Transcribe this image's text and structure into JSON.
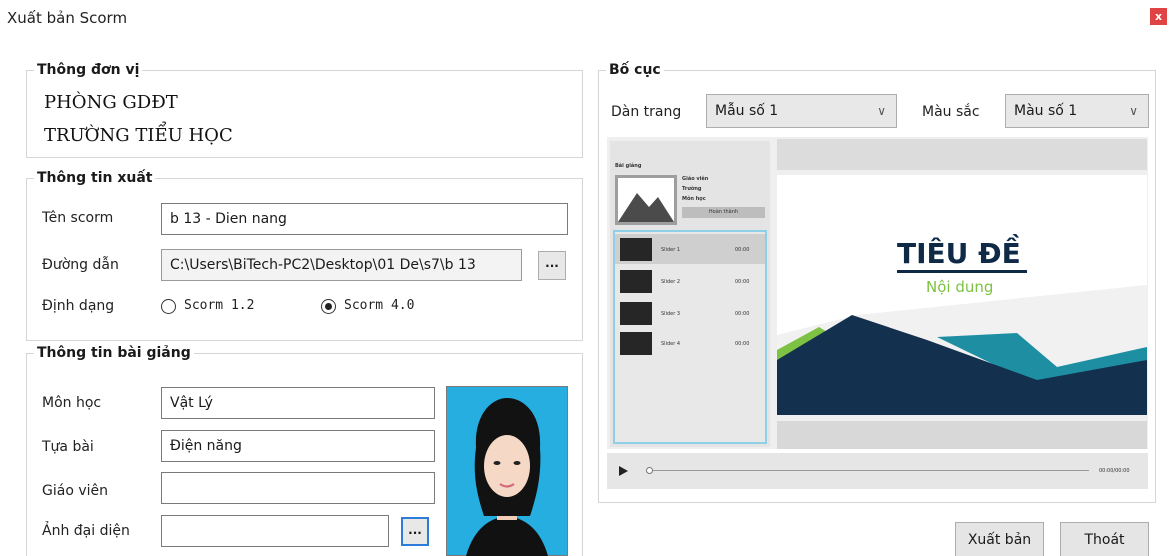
{
  "window": {
    "title": "Xuất bản Scorm",
    "close_label": "x"
  },
  "unit_info": {
    "legend": "Thông đơn vị",
    "line1": "PHÒNG GDĐT",
    "line2": "TRƯỜNG TIỂU HỌC"
  },
  "export_info": {
    "legend": "Thông tin xuất",
    "name_label": "Tên scorm",
    "name_value": "b 13 - Dien nang",
    "path_label": "Đường dẫn",
    "path_value": "C:\\Users\\BiTech-PC2\\Desktop\\01 De\\s7\\b 13",
    "browse_label": "...",
    "format_label": "Định dạng",
    "format_options": [
      "Scorm 1.2",
      "Scorm 4.0"
    ],
    "format_selected": "Scorm 4.0"
  },
  "lesson_info": {
    "legend": "Thông tin bài giảng",
    "subject_label": "Môn học",
    "subject_value": "Vật Lý",
    "title_label": "Tựa bài",
    "title_value": "Điện năng",
    "teacher_label": "Giáo viên",
    "teacher_value": "",
    "avatar_label": "Ảnh đại diện",
    "avatar_value": "",
    "browse_label": "..."
  },
  "layout": {
    "legend": "Bố cục",
    "page_label": "Dàn trang",
    "page_value": "Mẫu số 1",
    "color_label": "Màu sắc",
    "color_value": "Màu số 1"
  },
  "preview": {
    "sidebar_title": "Bài giảng",
    "info_lines": [
      "Giáo viên",
      "Trường",
      "Môn học"
    ],
    "complete_label": "Hoàn thành",
    "slides": [
      {
        "name": "Slider 1",
        "time": "00:00"
      },
      {
        "name": "Slider 2",
        "time": "00:00"
      },
      {
        "name": "Slider 3",
        "time": "00:00"
      },
      {
        "name": "Slider 4",
        "time": "00:00"
      }
    ],
    "slide_title": "TIÊU ĐỀ",
    "slide_subtitle": "Nội dung",
    "time_readout": "00:00/00:00",
    "colors": {
      "title": "#0e2a47",
      "subtitle": "#7dc242",
      "teal": "#1e8fa3",
      "navy": "#13304f"
    }
  },
  "actions": {
    "export_label": "Xuất bản",
    "exit_label": "Thoát"
  }
}
